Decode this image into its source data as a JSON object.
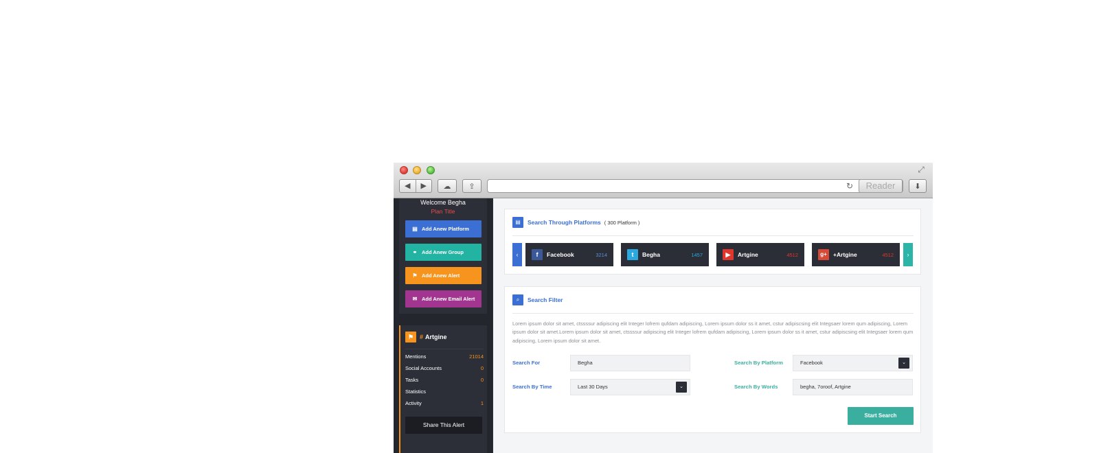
{
  "browser": {
    "nav_back": "◀",
    "nav_forward": "▶",
    "cloud_icon": "☁",
    "share_icon": "⇪",
    "reload_icon": "↻",
    "reader_label": "Reader",
    "download_icon": "⬇",
    "resize_icon": "⤢",
    "address": ""
  },
  "sidebar": {
    "welcome": "Welcome Begha",
    "plan_title": "Plan Title",
    "actions": [
      {
        "label": "Add Anew Platform",
        "icon": "▤",
        "color": "#3b6fd4"
      },
      {
        "label": "Add Anew Group",
        "icon": "⚭",
        "color": "#22b3a3"
      },
      {
        "label": "Add Anew Alert",
        "icon": "⚑",
        "color": "#f7941d"
      },
      {
        "label": "Add Anew Email Alert",
        "icon": "✉",
        "color": "#a2358f"
      }
    ],
    "alert": {
      "hash": "#",
      "name": "Artgine",
      "flag_icon": "⚑",
      "stats": [
        {
          "label": "Mentions",
          "value": "21014"
        },
        {
          "label": "Social Accounts",
          "value": "0"
        },
        {
          "label": "Tasks",
          "value": "0"
        },
        {
          "label": "Statistics",
          "value": ""
        },
        {
          "label": "Activity",
          "value": "1"
        }
      ],
      "share_label": "Share This Alert"
    }
  },
  "platforms_card": {
    "icon": "▤",
    "title": "Search Through Platforms",
    "subtitle": "( 300 Platform )",
    "prev_icon": "‹",
    "next_icon": "›",
    "items": [
      {
        "name": "Facebook",
        "count": "3214",
        "icon": "f",
        "icon_color": "#3b5998",
        "count_color": "#5b8fe0"
      },
      {
        "name": "Begha",
        "count": "1457",
        "icon": "t",
        "icon_color": "#2aa9e0",
        "count_color": "#2aa9e0"
      },
      {
        "name": "Artgine",
        "count": "4512",
        "icon": "▶",
        "icon_color": "#e0362e",
        "count_color": "#e0362e"
      },
      {
        "name": "+Artgine",
        "count": "4512",
        "icon": "g+",
        "icon_color": "#d64937",
        "count_color": "#e0362e"
      }
    ]
  },
  "filter_card": {
    "icon": "⌕",
    "title": "Search Filter",
    "description": "Lorem ipsum dolor sit amet, ctssssur adipiscing elit Integer lofrem qufdam adipiscing, Lorem ipsum dolor ss it amet, cstur adipiscsing elit Integsaer lorem qum adipiscing, Lorem ipsum dolor sit amet.Lorem ipsum dolor sit amet, ctssssur adipiscing elit Integer lofrem qufdam adipiscing, Lorem ipsum dolor ss it amet, cstur adipiscsing elit Integsaer lorem qum adipiscing, Lorem ipsum dolor sit amet.",
    "search_for_label": "Search For",
    "search_for_value": "Begha",
    "platform_label": "Search By Platform",
    "platform_value": "Facebook",
    "time_label": "Search By Time",
    "time_value": "Last 30 Days",
    "words_label": "Search By Words",
    "words_value": "begha, 7oroof, Artgine",
    "dropdown_icon": "⌄",
    "submit_label": "Start Search",
    "label_color": "#3b6fd4",
    "label_color_alt": "#3aafa0"
  }
}
